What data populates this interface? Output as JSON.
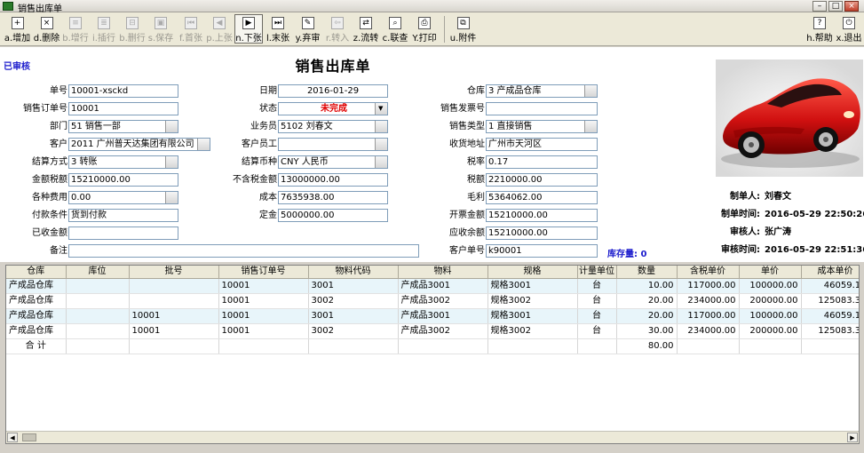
{
  "window": {
    "title": "销售出库单"
  },
  "toolbar": {
    "buttons": [
      {
        "label": "a.增加",
        "icon": "add-icon",
        "glyph": "+"
      },
      {
        "label": "d.删除",
        "icon": "delete-icon",
        "glyph": "×"
      },
      {
        "label": "b.增行",
        "icon": "insert-row-icon",
        "glyph": "≡"
      },
      {
        "label": "i.插行",
        "icon": "insert-line-icon",
        "glyph": "≣"
      },
      {
        "label": "b.删行",
        "icon": "delete-row-icon",
        "glyph": "⊟"
      },
      {
        "label": "s.保存",
        "icon": "save-icon",
        "glyph": "▣"
      },
      {
        "label": "f.首张",
        "icon": "first-icon",
        "glyph": "⏮"
      },
      {
        "label": "p.上张",
        "icon": "prev-icon",
        "glyph": "◀"
      },
      {
        "label": "n.下张",
        "icon": "next-icon",
        "glyph": "▶"
      },
      {
        "label": "l.末张",
        "icon": "last-icon",
        "glyph": "⏭"
      },
      {
        "label": "y.弃审",
        "icon": "unapprove-icon",
        "glyph": "✎"
      },
      {
        "label": "r.转入",
        "icon": "import-icon",
        "glyph": "⇦"
      },
      {
        "label": "z.流转",
        "icon": "transfer-icon",
        "glyph": "⇄"
      },
      {
        "label": "c.联查",
        "icon": "query-icon",
        "glyph": "⌕"
      },
      {
        "label": "Y.打印",
        "icon": "print-icon",
        "glyph": "⎙"
      },
      {
        "label": "u.附件",
        "icon": "attachment-icon",
        "glyph": "⧉"
      },
      {
        "label": "h.帮助",
        "icon": "help-icon",
        "glyph": "?"
      },
      {
        "label": "x.退出",
        "icon": "exit-icon",
        "glyph": "⏻"
      }
    ]
  },
  "form": {
    "status": "已审核",
    "title": "销售出库单",
    "fields": {
      "order_no": {
        "label": "单号",
        "value": "10001-xsckd"
      },
      "sales_order_no": {
        "label": "销售订单号",
        "value": "10001"
      },
      "department": {
        "label": "部门",
        "value": "51 销售一部"
      },
      "customer": {
        "label": "客户",
        "value": "2011 广州普天达集团有限公司"
      },
      "settle_method": {
        "label": "结算方式",
        "value": "3 转账"
      },
      "amount_tax": {
        "label": "金额税额",
        "value": "15210000.00"
      },
      "misc_fee": {
        "label": "各种费用",
        "value": "0.00"
      },
      "payment_terms": {
        "label": "付款条件",
        "value": "货到付款"
      },
      "received": {
        "label": "已收金额",
        "value": ""
      },
      "remark": {
        "label": "备注",
        "value": ""
      },
      "date": {
        "label": "日期",
        "value": "2016-01-29"
      },
      "state": {
        "label": "状态",
        "value": "未完成"
      },
      "salesman": {
        "label": "业务员",
        "value": "5102 刘春文"
      },
      "customer_staff": {
        "label": "客户员工",
        "value": ""
      },
      "currency": {
        "label": "结算币种",
        "value": "CNY 人民币"
      },
      "amount_no_tax": {
        "label": "不含税金额",
        "value": "13000000.00"
      },
      "cost": {
        "label": "成本",
        "value": "7635938.00"
      },
      "deposit": {
        "label": "定金",
        "value": "5000000.00"
      },
      "warehouse": {
        "label": "仓库",
        "value": "3 产成品仓库"
      },
      "invoice_no": {
        "label": "销售发票号",
        "value": ""
      },
      "sales_type": {
        "label": "销售类型",
        "value": "1 直接销售"
      },
      "delivery_addr": {
        "label": "收货地址",
        "value": "广州市天河区"
      },
      "tax_rate": {
        "label": "税率",
        "value": "0.17"
      },
      "tax_amount": {
        "label": "税额",
        "value": "2210000.00"
      },
      "gross_profit": {
        "label": "毛利",
        "value": "5364062.00"
      },
      "invoice_amount": {
        "label": "开票金额",
        "value": "15210000.00"
      },
      "receivable": {
        "label": "应收余额",
        "value": "15210000.00"
      },
      "customer_no": {
        "label": "客户单号",
        "value": "k90001"
      }
    },
    "stock": "库存量: 0",
    "info": {
      "creator_label": "制单人:",
      "creator": "刘春文",
      "create_time_label": "制单时间:",
      "create_time": "2016-05-29 22:50:26",
      "approver_label": "审核人:",
      "approver": "张广涛",
      "approve_time_label": "审核时间:",
      "approve_time": "2016-05-29 22:51:36"
    }
  },
  "grid": {
    "columns": [
      "仓库",
      "库位",
      "批号",
      "销售订单号",
      "物料代码",
      "物料",
      "规格",
      "计量单位",
      "数量",
      "含税单价",
      "单价",
      "成本单价"
    ],
    "rows": [
      [
        "产成品仓库",
        "",
        "",
        "10001",
        "3001",
        "产成品3001",
        "规格3001",
        "台",
        "10.00",
        "117000.00",
        "100000.00",
        "46059.10"
      ],
      [
        "产成品仓库",
        "",
        "",
        "10001",
        "3002",
        "产成品3002",
        "规格3002",
        "台",
        "20.00",
        "234000.00",
        "200000.00",
        "125083.30"
      ],
      [
        "产成品仓库",
        "",
        "10001",
        "10001",
        "3001",
        "产成品3001",
        "规格3001",
        "台",
        "20.00",
        "117000.00",
        "100000.00",
        "46059.10"
      ],
      [
        "产成品仓库",
        "",
        "10001",
        "10001",
        "3002",
        "产成品3002",
        "规格3002",
        "台",
        "30.00",
        "234000.00",
        "200000.00",
        "125083.30"
      ]
    ],
    "total_label": "合 计",
    "total_qty": "80.00"
  }
}
